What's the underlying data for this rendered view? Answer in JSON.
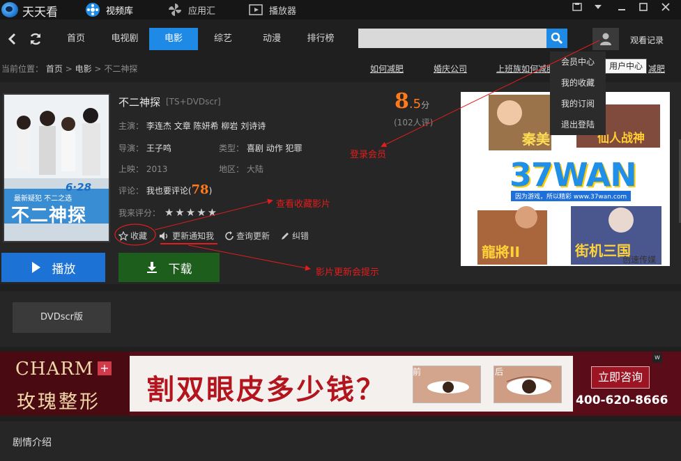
{
  "app": {
    "name": "天天看"
  },
  "top_tabs": [
    {
      "label": "视频库",
      "active": true
    },
    {
      "label": "应用汇",
      "active": false
    },
    {
      "label": "播放器",
      "active": false
    }
  ],
  "nav": {
    "items": [
      {
        "label": "首页"
      },
      {
        "label": "电视剧"
      },
      {
        "label": "电影"
      },
      {
        "label": "综艺"
      },
      {
        "label": "动漫"
      },
      {
        "label": "排行榜"
      }
    ],
    "active_index": 2,
    "search_value": "",
    "watch_history": "观看记录"
  },
  "user_menu": {
    "items": [
      "会员中心",
      "我的收藏",
      "我的订阅",
      "退出登陆"
    ],
    "tooltip": "用户中心"
  },
  "breadcrumb": {
    "prefix": "当前位置：",
    "crumbs": [
      "首页",
      "电影",
      "不二神探"
    ],
    "separator": ">"
  },
  "hot_links": [
    "如何减肥",
    "婚庆公司",
    "上班族如何减肥",
    "减肥"
  ],
  "movie": {
    "title": "不二神探",
    "tag": "[TS+DVDscr]",
    "cast_label": "主演：",
    "cast": [
      "李连杰",
      "文章",
      "陈妍希",
      "柳岩",
      "刘诗诗"
    ],
    "director_label": "导演：",
    "director": "王子鸣",
    "genre_label": "类型：",
    "genres": [
      "喜剧",
      "动作",
      "犯罪"
    ],
    "release_label": "上映：",
    "release": "2013",
    "region_label": "地区：",
    "region": "大陆",
    "comment_label": "评论：",
    "comment_link": "我也要评论(",
    "comment_score": "78",
    "comment_close": ")",
    "my_rating_label": "我来评分：",
    "stars": 5,
    "score_int": "8",
    "score_dec": ".5",
    "score_unit": "分",
    "rating_count": "(102人评)"
  },
  "poster": {
    "date_text": "6·28",
    "title_text": "不二神探",
    "slogan": "最新疑犯 不二之选"
  },
  "actions": [
    {
      "label": "收藏",
      "icon": "star-icon"
    },
    {
      "label": "更新通知我",
      "icon": "speaker-icon"
    },
    {
      "label": "查询更新",
      "icon": "refresh-icon"
    },
    {
      "label": "纠错",
      "icon": "pencil-icon"
    }
  ],
  "buttons": {
    "play": "播放",
    "download": "下载"
  },
  "game_ad": {
    "brand": "37WAN",
    "tagline": "因为游戏，所以精彩 www.37wan.com",
    "games": [
      "秦美",
      "仙人战神",
      "龍將II",
      "街机三国"
    ],
    "credit": "创速传媒"
  },
  "version": {
    "label": "DVDscr版"
  },
  "banner_ad": {
    "brand_en": "CHARM",
    "brand_cn": "玫瑰整形",
    "headline": "割双眼皮多少钱？",
    "before": "前",
    "after": "后",
    "cta": "立即咨询",
    "phone": "400-620-8666",
    "corner": "w"
  },
  "plot": {
    "heading": "剧情介绍"
  },
  "annotations": {
    "login": "登录会员",
    "favorites": "查看收藏影片",
    "update": "影片更新会提示"
  },
  "colors": {
    "accent": "#1e8ae6",
    "play": "#1d72d6",
    "download": "#1d5e1d",
    "score": "#ff7a1a",
    "annotation": "#e21d1d"
  }
}
